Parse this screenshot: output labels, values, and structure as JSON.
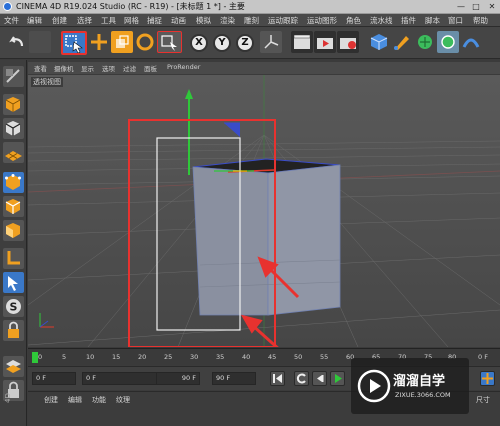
{
  "window": {
    "title": "CINEMA 4D R19.024 Studio (RC - R19) - [未标题 1 *] - 主要",
    "minimize": "—",
    "maximize": "□",
    "close": "✕"
  },
  "menu": [
    "文件",
    "编辑",
    "创建",
    "选择",
    "工具",
    "网格",
    "捕捉",
    "动画",
    "模拟",
    "渲染",
    "雕刻",
    "运动跟踪",
    "运动图形",
    "角色",
    "流水线",
    "插件",
    "脚本",
    "窗口",
    "帮助"
  ],
  "toolbar": {
    "axis_x": "X",
    "axis_y": "Y",
    "axis_z": "Z"
  },
  "viewport": {
    "menu": [
      "查看",
      "摄像机",
      "显示",
      "选项",
      "过滤",
      "面板",
      "ProRender"
    ],
    "label": "透视视图"
  },
  "timeline": {
    "ticks": [
      "0",
      "5",
      "10",
      "15",
      "20",
      "25",
      "30",
      "35",
      "40",
      "45",
      "50",
      "55",
      "60",
      "65",
      "70",
      "75",
      "80"
    ],
    "end_label": "0 F"
  },
  "transport": {
    "start_frame": "0 F",
    "current_frame": "0 F",
    "max_frame": "90 F",
    "end_frame": "90 F"
  },
  "bottom_panel": {
    "tabs": [
      "创建",
      "编辑",
      "功能",
      "纹理"
    ],
    "right_label": "尺寸"
  },
  "side_label": "4D",
  "watermark": {
    "title": "溜溜自学",
    "url": "ZIXUE.3066.COM"
  },
  "colors": {
    "highlight_box": "#e8322f",
    "axis_y": "#2fc83a",
    "axis_x": "#e03a2a",
    "active_tool": "#3a78c8"
  }
}
